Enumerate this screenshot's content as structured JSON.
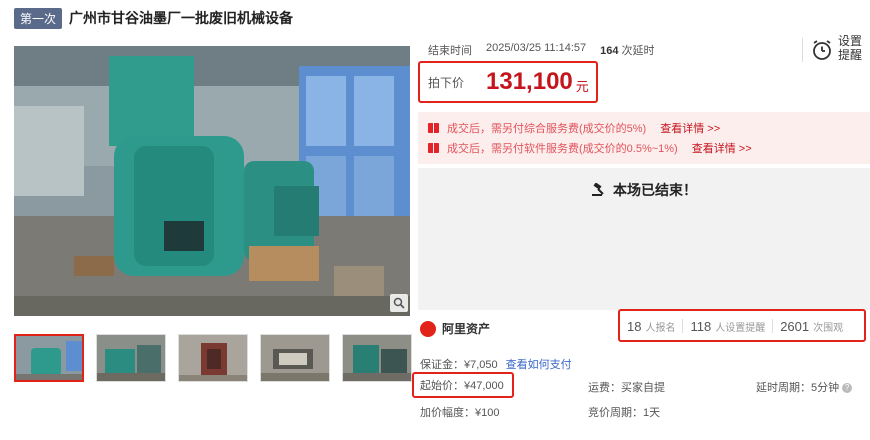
{
  "title": {
    "round_badge": "第一次",
    "text": "广州市甘谷油墨厂一批废旧机械设备"
  },
  "auction": {
    "end_label": "结束时间",
    "end_time": "2025/03/25 11:14:57",
    "delay_count": "164",
    "delay_unit": "次延时",
    "remind_label_1": "设置",
    "remind_label_2": "提醒"
  },
  "price": {
    "label": "拍下价",
    "value": "131,100",
    "unit": "元"
  },
  "fees": [
    {
      "text": "成交后，需另付综合服务费(成交价的5%)",
      "link": "查看详情 >>"
    },
    {
      "text": "成交后，需另付软件服务费(成交价的0.5%~1%)",
      "link": "查看详情 >>"
    }
  ],
  "status": {
    "ended_text": "本场已结束！"
  },
  "platform": {
    "name": "阿里资产"
  },
  "stats": [
    {
      "num": "18",
      "unit": "人报名"
    },
    {
      "num": "118",
      "unit": "人设置提醒"
    },
    {
      "num": "2601",
      "unit": "次围观"
    }
  ],
  "details": {
    "deposit": "保证金：¥7,050",
    "deposit_link": "查看如何支付",
    "start_price": "起始价：¥47,000",
    "shipping": "运费：买家自提",
    "delay_period": "延时周期：5分钟",
    "increment": "加价幅度：¥100",
    "bid_period": "竞价周期：1天"
  },
  "colors": {
    "accent": "#e2231a",
    "price": "#c4141c",
    "link": "#3a67c8",
    "badge": "#5a6a8a"
  }
}
